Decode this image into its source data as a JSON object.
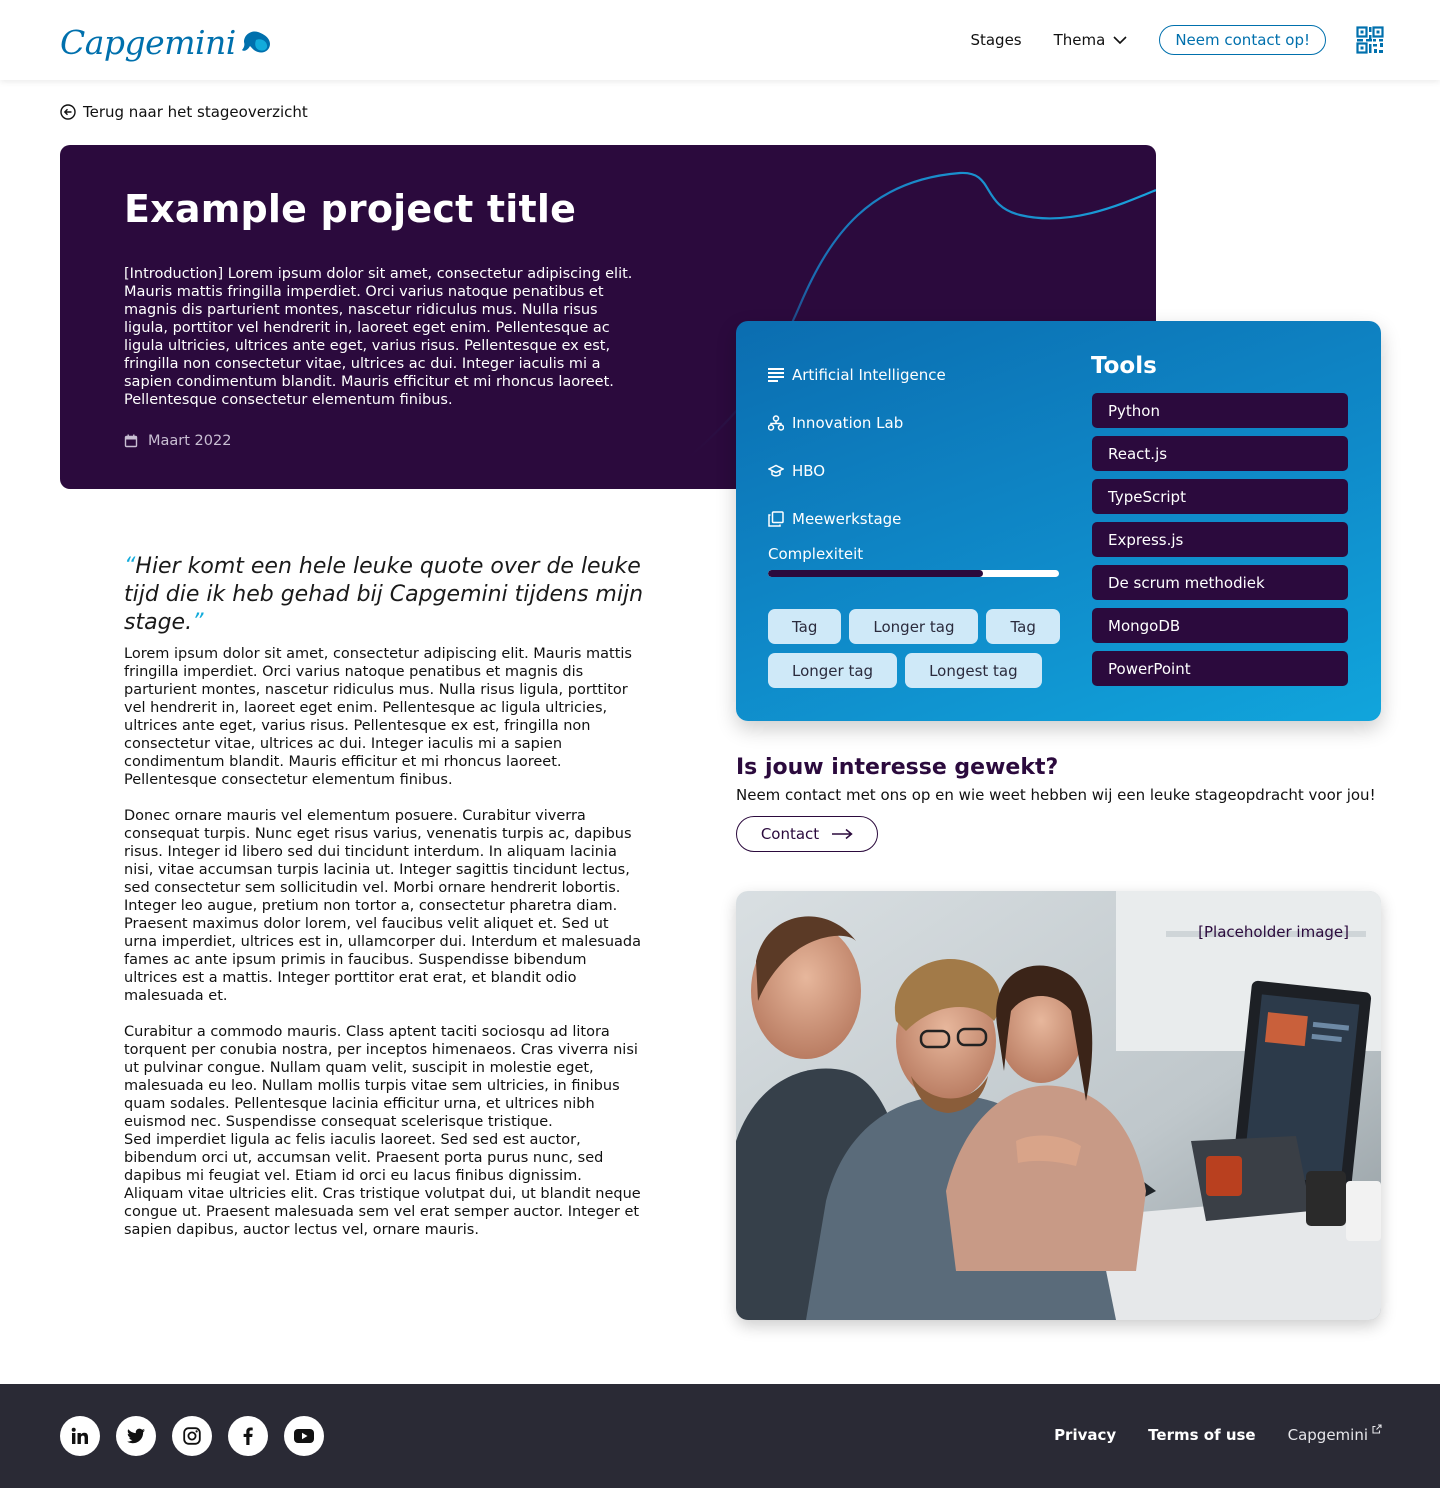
{
  "header": {
    "logo_text": "Capgemini",
    "nav": [
      {
        "label": "Stages"
      },
      {
        "label": "Thema"
      }
    ],
    "contact_label": "Neem contact op!"
  },
  "back_link": "Terug naar het stageoverzicht",
  "hero": {
    "title": "Example project title",
    "intro": "[Introduction] Lorem ipsum dolor sit amet, consectetur adipiscing elit. Mauris mattis fringilla imperdiet. Orci varius natoque penatibus et magnis dis parturient montes, nascetur ridiculus mus. Nulla risus ligula, porttitor vel hendrerit in, laoreet eget enim. Pellentesque ac ligula ultricies, ultrices ante eget, varius risus. Pellentesque ex est, fringilla non consectetur vitae, ultrices ac dui. Integer iaculis mi a sapien condimentum blandit. Mauris efficitur et mi rhoncus laoreet. Pellentesque consectetur elementum finibus.",
    "date": "Maart 2022"
  },
  "info": {
    "meta": [
      {
        "icon": "list-icon",
        "label": "Artificial Intelligence"
      },
      {
        "icon": "org-icon",
        "label": "Innovation Lab"
      },
      {
        "icon": "graduation-cap-icon",
        "label": "HBO"
      },
      {
        "icon": "copy-icon",
        "label": "Meewerkstage"
      }
    ],
    "complexity_label": "Complexiteit",
    "complexity_value": 0.74,
    "tags": [
      "Tag",
      "Longer tag",
      "Tag",
      "Longer tag",
      "Longest tag"
    ],
    "tools_title": "Tools",
    "tools": [
      "Python",
      "React.js",
      "TypeScript",
      "Express.js",
      "De scrum methodiek",
      "MongoDB",
      "PowerPoint"
    ]
  },
  "quote": {
    "open": "“",
    "text": "Hier komt een hele leuke quote over de leuke tijd die ik heb gehad bij Capgemini tijdens mijn stage.",
    "close": "”"
  },
  "body": {
    "p1": "Lorem ipsum dolor sit amet, consectetur adipiscing elit. Mauris mattis fringilla imperdiet. Orci varius natoque penatibus et magnis dis parturient montes, nascetur ridiculus mus. Nulla risus ligula, porttitor vel hendrerit in, laoreet eget enim. Pellentesque ac ligula ultricies, ultrices ante eget, varius risus. Pellentesque ex est, fringilla non consectetur vitae, ultrices ac dui. Integer iaculis mi a sapien condimentum blandit. Mauris efficitur et mi rhoncus laoreet. Pellentesque consectetur elementum finibus.",
    "p2": "Donec ornare mauris vel elementum posuere. Curabitur viverra consequat turpis. Nunc eget risus varius, venenatis turpis ac, dapibus risus. Integer id libero sed dui tincidunt interdum. In aliquam lacinia nisi, vitae accumsan turpis lacinia ut. Integer sagittis tincidunt lectus, sed consectetur sem sollicitudin vel. Morbi ornare hendrerit lobortis. Integer leo augue, pretium non tortor a, consectetur pharetra diam. Praesent maximus dolor lorem, vel faucibus velit aliquet et. Sed ut urna imperdiet, ultrices est in, ullamcorper dui. Interdum et malesuada fames ac ante ipsum primis in faucibus. Suspendisse bibendum ultrices est a mattis. Integer porttitor erat erat, et blandit odio malesuada et.",
    "p3": "Curabitur a commodo mauris. Class aptent taciti sociosqu ad litora torquent per conubia nostra, per inceptos himenaeos. Cras viverra nisi ut pulvinar congue. Nullam quam velit, suscipit in molestie eget, malesuada eu leo. Nullam mollis turpis vitae sem ultricies, in finibus quam sodales. Pellentesque lacinia efficitur urna, et ultrices nibh euismod nec. Suspendisse consequat scelerisque tristique.",
    "p4": "Sed imperdiet ligula ac felis iaculis laoreet. Sed sed est auctor, bibendum orci ut, accumsan velit. Praesent porta purus nunc, sed dapibus mi feugiat vel. Etiam id orci eu lacus finibus dignissim. Aliquam vitae ultricies elit. Cras tristique volutpat dui, ut blandit neque congue ut. Praesent malesuada sem vel erat semper auctor. Integer et sapien dapibus, auctor lectus vel, ornare mauris."
  },
  "interest": {
    "title": "Is jouw interesse gewekt?",
    "subtitle": "Neem contact met ons op en wie weet hebben wij een leuke stageopdracht voor jou!",
    "button": "Contact"
  },
  "photo": {
    "caption": "[Placeholder image]"
  },
  "footer": {
    "socials": [
      "linkedin-icon",
      "twitter-icon",
      "instagram-icon",
      "facebook-icon",
      "youtube-icon"
    ],
    "links": [
      "Privacy",
      "Terms of use"
    ],
    "external": "Capgemini"
  },
  "colors": {
    "brand_blue": "#0070ad",
    "deep_purple": "#2b0a3d",
    "accent_cyan": "#12abdb",
    "footer_bg": "#2a2a35"
  }
}
